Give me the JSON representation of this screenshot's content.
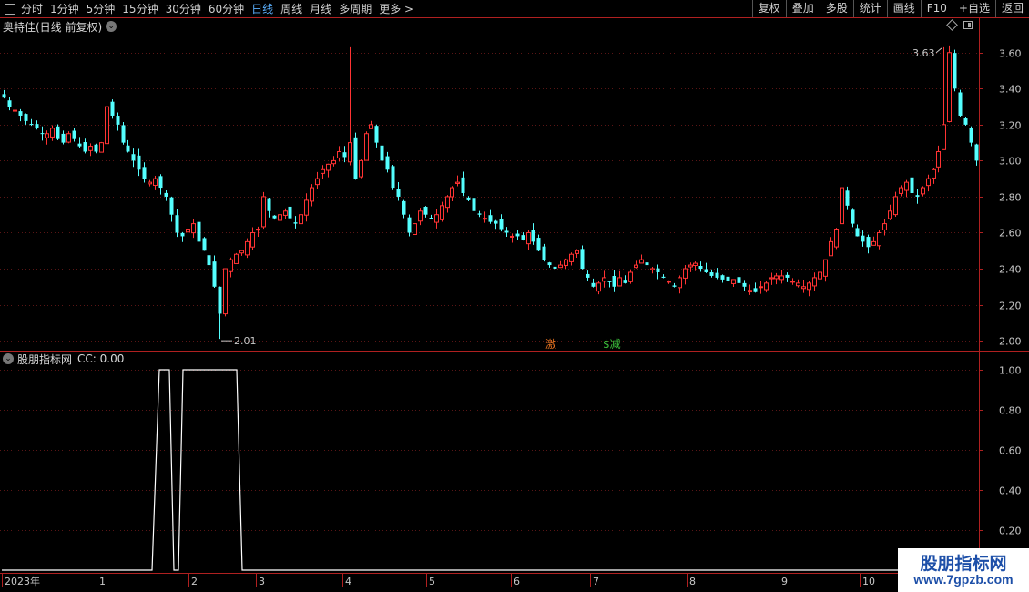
{
  "toolbar": {
    "periods": [
      "分时",
      "1分钟",
      "5分钟",
      "15分钟",
      "30分钟",
      "60分钟",
      "日线",
      "周线",
      "月线",
      "多周期",
      "更多 >"
    ],
    "active_period": "日线",
    "right_buttons": [
      "复权",
      "叠加",
      "多股",
      "统计",
      "画线",
      "F10",
      "+自选",
      "返回"
    ]
  },
  "main": {
    "title": "奥特佳(日线 前复权)",
    "high_label": "3.63",
    "low_label": "2.01",
    "y_ticks": [
      "3.60",
      "3.40",
      "3.20",
      "3.00",
      "2.80",
      "2.60",
      "2.40",
      "2.20",
      "2.00"
    ],
    "markers": [
      {
        "text": "激",
        "color": "#e07020"
      },
      {
        "text": "$减",
        "color": "#3cc03c"
      }
    ]
  },
  "sub": {
    "title": "股朋指标网",
    "cc_label": "CC: 0.00",
    "y_ticks": [
      "1.00",
      "0.80",
      "0.60",
      "0.40",
      "0.20"
    ]
  },
  "x_axis": {
    "labels": [
      "2023年",
      "1",
      "2",
      "3",
      "4",
      "5",
      "6",
      "7",
      "8",
      "9",
      "10"
    ]
  },
  "watermark": {
    "line1": "股朋指标网",
    "line2": "www.7gpzb.com"
  },
  "colors": {
    "up": "#ff3333",
    "down": "#54ffff",
    "axis": "#b02020",
    "active": "#5ab0ff"
  },
  "chart_data": [
    {
      "type": "candlestick",
      "title": "奥特佳(日线 前复权)",
      "ylim": [
        1.95,
        3.7
      ],
      "annotations": {
        "high": 3.63,
        "low": 2.01
      },
      "close": [
        3.35,
        3.3,
        3.28,
        3.25,
        3.22,
        3.2,
        3.18,
        3.15,
        3.15,
        3.18,
        3.12,
        3.1,
        3.15,
        3.12,
        3.08,
        3.05,
        3.08,
        3.05,
        3.1,
        3.3,
        3.25,
        3.2,
        3.1,
        3.05,
        3.0,
        2.95,
        2.9,
        2.88,
        2.9,
        2.85,
        2.8,
        2.7,
        2.6,
        2.58,
        2.62,
        2.65,
        2.55,
        2.5,
        2.42,
        2.3,
        2.15,
        2.4,
        2.45,
        2.48,
        2.5,
        2.55,
        2.6,
        2.62,
        2.8,
        2.72,
        2.68,
        2.7,
        2.72,
        2.68,
        2.65,
        2.7,
        2.78,
        2.85,
        2.9,
        2.95,
        2.98,
        3.0,
        3.05,
        3.02,
        3.1,
        2.9,
        3.0,
        3.15,
        3.2,
        3.1,
        3.0,
        2.95,
        2.85,
        2.8,
        2.7,
        2.6,
        2.65,
        2.72,
        2.7,
        2.68,
        2.7,
        2.75,
        2.8,
        2.85,
        2.88,
        2.82,
        2.78,
        2.72,
        2.7,
        2.68,
        2.66,
        2.65,
        2.62,
        2.6,
        2.58,
        2.58,
        2.56,
        2.6,
        2.55,
        2.5,
        2.45,
        2.42,
        2.4,
        2.42,
        2.45,
        2.48,
        2.5,
        2.4,
        2.35,
        2.3,
        2.32,
        2.35,
        2.33,
        2.3,
        2.35,
        2.32,
        2.38,
        2.42,
        2.45,
        2.42,
        2.4,
        2.38,
        2.35,
        2.33,
        2.3,
        2.35,
        2.4,
        2.42,
        2.43,
        2.4,
        2.38,
        2.36,
        2.35,
        2.34,
        2.33,
        2.34,
        2.32,
        2.3,
        2.28,
        2.27,
        2.3,
        2.32,
        2.35,
        2.36,
        2.36,
        2.35,
        2.33,
        2.32,
        2.3,
        2.32,
        2.35,
        2.38,
        2.45,
        2.55,
        2.62,
        2.85,
        2.75,
        2.65,
        2.58,
        2.55,
        2.52,
        2.55,
        2.6,
        2.65,
        2.72,
        2.8,
        2.85,
        2.88,
        2.82,
        2.8,
        2.85,
        2.9,
        2.95,
        3.05,
        3.2,
        3.6,
        3.4,
        3.25,
        3.2,
        3.1,
        3.0
      ]
    },
    {
      "type": "line",
      "title": "股朋指标网",
      "series": [
        {
          "name": "CC",
          "last_value": 0.0
        }
      ],
      "ylim": [
        0,
        1.05
      ],
      "segments": [
        {
          "x_from": 0,
          "x_to": 44.6,
          "y": 0
        },
        {
          "x_from": 46.0,
          "x_to": 48.2,
          "y": 1
        },
        {
          "x_from": 49.4,
          "x_to": 55.4,
          "y": 0
        },
        {
          "x_from": 52.6,
          "x_to": 66.4,
          "y": 1
        },
        {
          "x_from": 66.4,
          "x_to": 100,
          "y": 0
        }
      ]
    }
  ]
}
